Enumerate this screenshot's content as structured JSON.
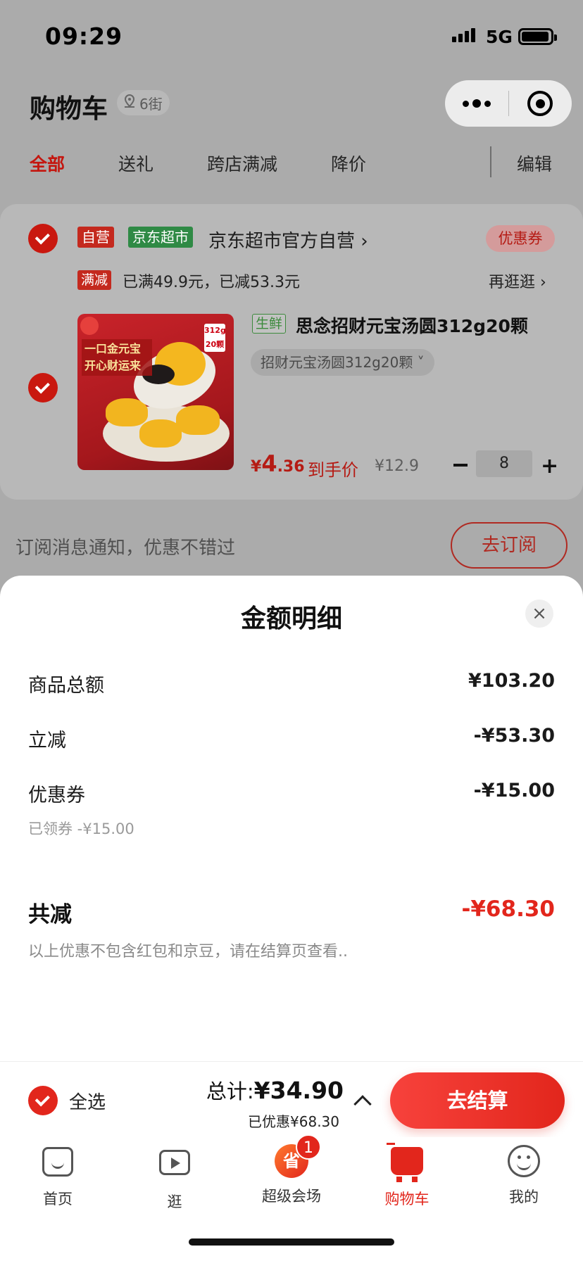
{
  "status_bar": {
    "time": "09:29",
    "network": "5G"
  },
  "header": {
    "title": "购物车",
    "location": "6街"
  },
  "tabs": [
    {
      "label": "全部",
      "active": true
    },
    {
      "label": "送礼",
      "active": false
    },
    {
      "label": "跨店满减",
      "active": false
    },
    {
      "label": "降价",
      "active": false
    }
  ],
  "edit_label": "编辑",
  "shop": {
    "tag_self": "自营",
    "tag_market": "京东超市",
    "name": "京东超市官方自营 ›",
    "coupon_label": "优惠券",
    "promo_tag": "满减",
    "promo_text": "已满49.9元，已减53.3元",
    "more_link": "再逛逛 ›"
  },
  "product": {
    "fresh_tag": "生鲜",
    "name": "思念招财元宝汤圆312g20颗",
    "spec": "招财元宝汤圆312g20颗 ˅",
    "image_text_line1": "一口金元宝",
    "image_text_line2": "开心财运来",
    "image_badge_1": "312g",
    "image_badge_2": "20颗",
    "price_symbol": "¥",
    "price_int": "4",
    "price_dec": ".36",
    "price_label": "到手价",
    "original_price": "¥12.9",
    "quantity": "8",
    "minus_label": "−",
    "plus_label": "+"
  },
  "subscribe": {
    "text": "订阅消息通知，优惠不错过",
    "button": "去订阅"
  },
  "sheet": {
    "title": "金额明细",
    "close": "×",
    "rows": [
      {
        "label": "商品总额",
        "value": "¥103.20"
      },
      {
        "label": "立减",
        "value": "-¥53.30"
      },
      {
        "label": "优惠券",
        "value": "-¥15.00"
      }
    ],
    "coupon_sub": "已领券 -¥15.00",
    "total_label": "共减",
    "total_value": "-¥68.30",
    "note": "以上优惠不包含红包和京豆，请在结算页查看.."
  },
  "checkout": {
    "select_all": "全选",
    "sum_label": "总计:",
    "sum_value": "¥34.90",
    "saved": "已优惠¥68.30",
    "pay_button": "去结算"
  },
  "tabbar": [
    {
      "label": "首页",
      "icon": "home-icon"
    },
    {
      "label": "逛",
      "icon": "video-icon"
    },
    {
      "label": "超级会场",
      "icon": "super-venue-icon",
      "badge": "1"
    },
    {
      "label": "购物车",
      "icon": "cart-icon",
      "active": true
    },
    {
      "label": "我的",
      "icon": "profile-icon"
    }
  ],
  "colors": {
    "accent": "#e2261c",
    "muted_accent": "#c4160f",
    "overlay": "#ababab"
  }
}
